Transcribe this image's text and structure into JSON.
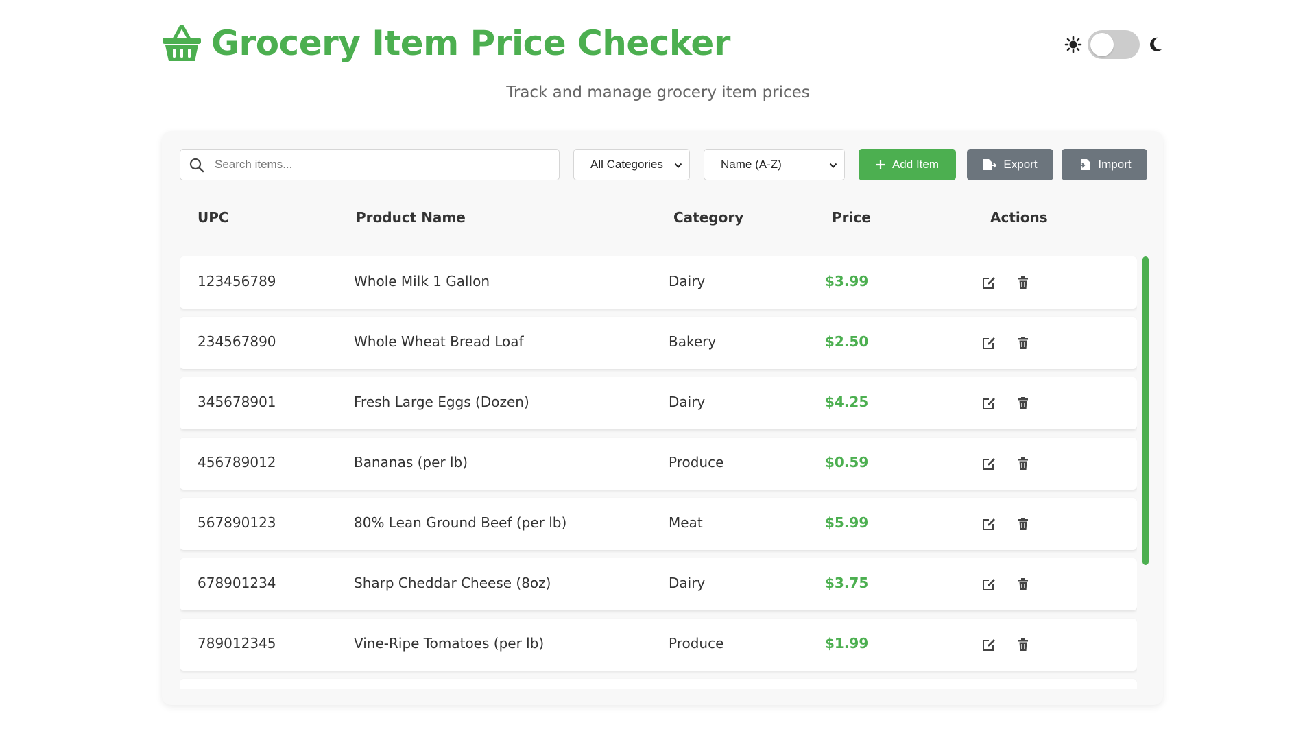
{
  "header": {
    "title": "Grocery Item Price Checker",
    "subtitle": "Track and manage grocery item prices",
    "icon": "basket-icon",
    "theme_icons": [
      "sun-icon",
      "moon-icon"
    ],
    "dark_mode": false
  },
  "toolbar": {
    "search_placeholder": "Search items...",
    "search_value": "",
    "category_selected": "All Categories",
    "sort_selected": "Name (A-Z)",
    "add_label": "Add Item",
    "export_label": "Export",
    "import_label": "Import"
  },
  "table": {
    "columns": [
      "UPC",
      "Product Name",
      "Category",
      "Price",
      "Actions"
    ],
    "rows": [
      {
        "upc": "123456789",
        "name": "Whole Milk 1 Gallon",
        "category": "Dairy",
        "price": "$3.99"
      },
      {
        "upc": "234567890",
        "name": "Whole Wheat Bread Loaf",
        "category": "Bakery",
        "price": "$2.50"
      },
      {
        "upc": "345678901",
        "name": "Fresh Large Eggs (Dozen)",
        "category": "Dairy",
        "price": "$4.25"
      },
      {
        "upc": "456789012",
        "name": "Bananas (per lb)",
        "category": "Produce",
        "price": "$0.59"
      },
      {
        "upc": "567890123",
        "name": "80% Lean Ground Beef (per lb)",
        "category": "Meat",
        "price": "$5.99"
      },
      {
        "upc": "678901234",
        "name": "Sharp Cheddar Cheese (8oz)",
        "category": "Dairy",
        "price": "$3.75"
      },
      {
        "upc": "789012345",
        "name": "Vine-Ripe Tomatoes (per lb)",
        "category": "Produce",
        "price": "$1.99"
      }
    ],
    "row_actions": [
      "edit-icon",
      "trash-icon"
    ]
  },
  "colors": {
    "accent": "#4caf50",
    "secondary_button": "#6c757d"
  }
}
